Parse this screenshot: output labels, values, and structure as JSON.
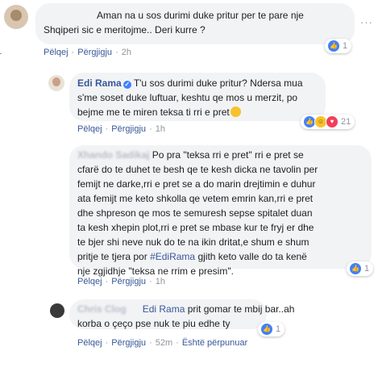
{
  "colors": {
    "link": "#385898",
    "bubble": "#f2f3f5",
    "muted": "#90949c",
    "like": "#4080ff"
  },
  "comments": [
    {
      "author": "",
      "text_lines": [
        "Aman na u sos durimi duke pritur per te pare nje",
        "Shqiperi sic e meritojme.. Deri kurre ?"
      ],
      "actions": {
        "like": "Pëlqej",
        "reply": "Përgjigju",
        "time": "2h"
      },
      "reactions": {
        "count": "1",
        "icons": [
          "like"
        ]
      }
    },
    {
      "author": "Edi Rama",
      "text_lines": [
        "T'u sos durimi duke pritur? Ndersa mua",
        "s'me soset duke luftuar, keshtu qe mos u merzit, po",
        "bejme me te miren teksa ti rri e pret"
      ],
      "actions": {
        "like": "Pëlqej",
        "reply": "Përgjigju",
        "time": "1h"
      },
      "reactions": {
        "count": "21",
        "icons": [
          "like",
          "haha",
          "love"
        ]
      }
    },
    {
      "author": "Xhando Sadikaj",
      "text_lines": [
        "Po pra \"teksa rri e pret\" rri e pret se",
        "cfarë do te duhet te besh qe te kesh dicka ne tavolin per",
        "femijt ne darke,rri e pret se a do marin drejtimin e duhur",
        "ata femijt me keto shkolla qe vetem emrin kan,rri e pret",
        "dhe shpreson qe mos te semuresh sepse spitalet duan",
        "ta kesh xhepin plot,rri e pret se mbase kur te fryj er dhe",
        "te bjer shi neve nuk do te na ikin dritat,e shum e shum",
        "pritje te tjera por",
        "gjith keto valle do ta kenë",
        "nje zgjidhje \"teksa ne rrim e presim\"."
      ],
      "hashtag": "#EdiRama",
      "actions": {
        "like": "Pëlqej",
        "reply": "Përgjigju",
        "time": "1h"
      },
      "reactions": {
        "count": "1",
        "icons": [
          "like"
        ]
      }
    },
    {
      "author": "Chris Clog",
      "mention": "Edi Rama",
      "text_lines": [
        "prit gomar te mbij bar..ah",
        "korba o çeço pse nuk te piu edhe ty"
      ],
      "actions": {
        "like": "Pëlqej",
        "reply": "Përgjigju",
        "time": "52m",
        "edited": "Është përpunuar"
      },
      "reactions": {
        "count": "1",
        "icons": [
          "like"
        ]
      }
    }
  ]
}
